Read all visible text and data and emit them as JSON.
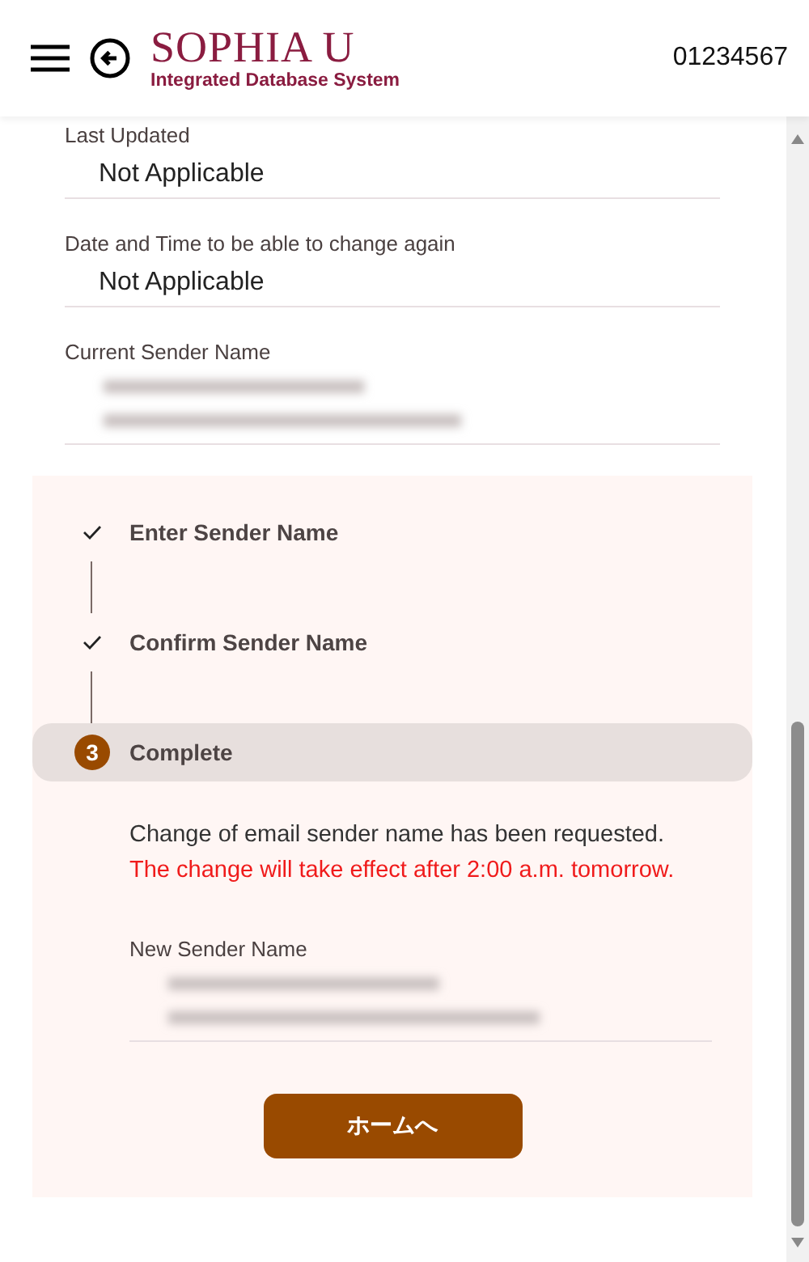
{
  "header": {
    "logo_title": "SOPHIA U",
    "logo_subtitle": "Integrated Database System",
    "user_id": "01234567"
  },
  "fields": [
    {
      "label": "Last Updated",
      "value": "Not Applicable",
      "kind": "text"
    },
    {
      "label": "Date and Time to be able to change again",
      "value": "Not Applicable",
      "kind": "text"
    },
    {
      "label": "Current Sender Name",
      "kind": "redacted"
    }
  ],
  "steps": [
    {
      "label": "Enter Sender Name",
      "kind": "done",
      "selected": false
    },
    {
      "label": "Confirm Sender Name",
      "kind": "done",
      "selected": false
    },
    {
      "label": "Complete",
      "kind": "current",
      "number": "3",
      "selected": true
    }
  ],
  "message": {
    "text": "Change of email sender name has been requested.",
    "notice": "The change will take effect after 2:00 a.m. tomorrow."
  },
  "new_sender": {
    "label": "New Sender Name",
    "kind": "redacted"
  },
  "home_button": "ホームへ"
}
